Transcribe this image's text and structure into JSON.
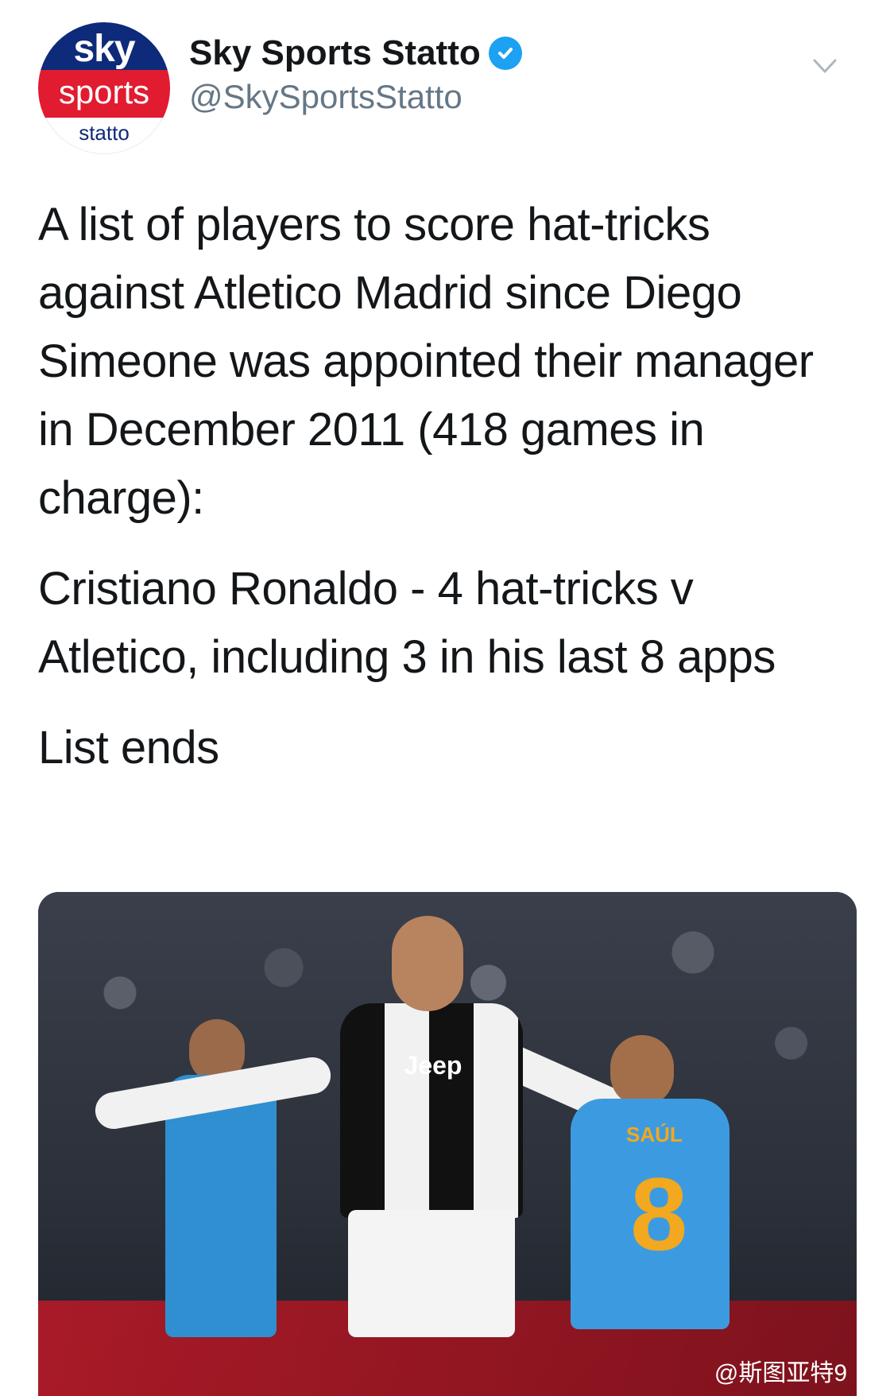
{
  "account": {
    "display_name": "Sky Sports Statto",
    "handle": "@SkySportsStatto",
    "avatar_text_top": "sky",
    "avatar_text_mid": "sports",
    "avatar_text_bottom": "statto"
  },
  "tweet": {
    "paragraphs": [
      "A list of players to score hat-tricks against Atletico Madrid since Diego Simeone was appointed their manager in December 2011 (418 games in charge):",
      "Cristiano Ronaldo - 4 hat-tricks v Atletico, including 3 in his last 8 apps",
      "List ends"
    ]
  },
  "media": {
    "shirt_sponsor": "Jeep",
    "opponent_name": "SAÚL",
    "opponent_number": "8",
    "watermark": "@斯图亚特9"
  },
  "icons": {
    "verified": "verified-badge-icon",
    "chevron": "chevron-down-icon"
  },
  "colors": {
    "verified_blue": "#1da1f2",
    "sky_navy": "#0e2a7a",
    "sky_red": "#e11b30"
  }
}
